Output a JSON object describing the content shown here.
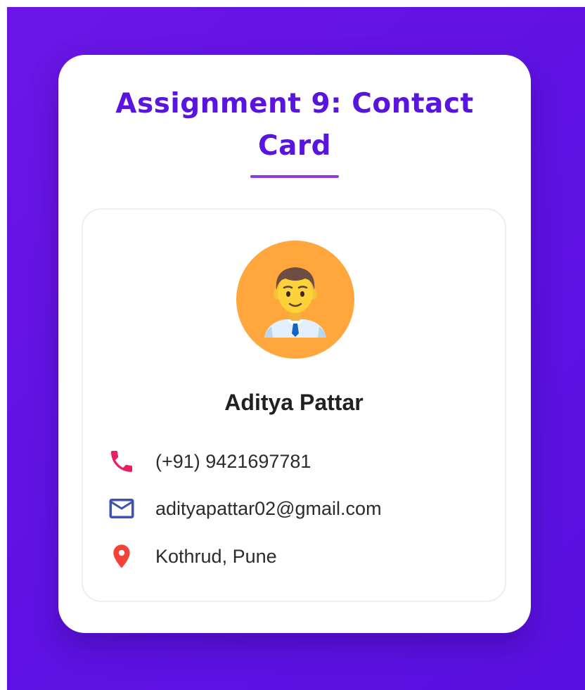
{
  "header": {
    "title": "Assignment 9: Contact Card"
  },
  "profile": {
    "name": "Aditya Pattar",
    "avatar_icon": "man-office-worker-emoji"
  },
  "contacts": [
    {
      "icon": "phone-icon",
      "value": "(+91) 9421697781",
      "color": "#e91e63"
    },
    {
      "icon": "mail-icon",
      "value": "adityapattar02@gmail.com",
      "color": "#3f51b5"
    },
    {
      "icon": "location-pin-icon",
      "value": "Kothrud, Pune",
      "color": "#f44336"
    }
  ],
  "colors": {
    "background": "#6214e4",
    "title": "#5a14df",
    "underline": "#8a3de6",
    "avatar_bg": "#ffa63d"
  }
}
